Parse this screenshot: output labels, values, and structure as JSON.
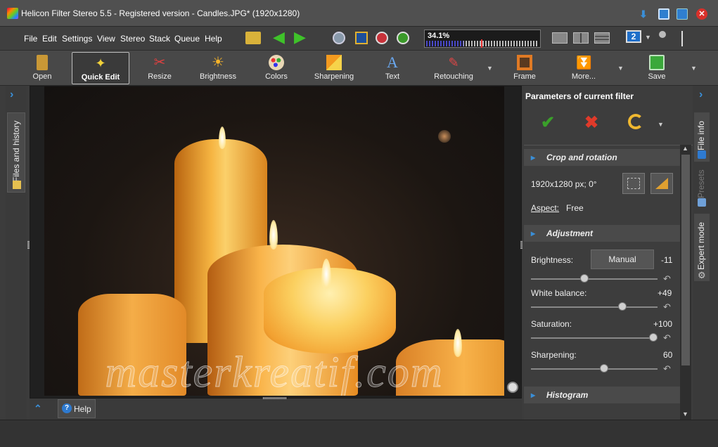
{
  "window": {
    "title": "Helicon Filter Stereo 5.5 - Registered version - Candles.JPG* (1920x1280)"
  },
  "menu": [
    "File",
    "Edit",
    "Settings",
    "View",
    "Stereo",
    "Stack",
    "Queue",
    "Help"
  ],
  "zoom": {
    "label": "34.1%",
    "value": 34.1
  },
  "monitor_badge": "2",
  "toolbar": {
    "open": "Open",
    "quick_edit": "Quick Edit",
    "resize": "Resize",
    "brightness": "Brightness",
    "colors": "Colors",
    "sharpening": "Sharpening",
    "text": "Text",
    "retouching": "Retouching",
    "frame": "Frame",
    "more": "More...",
    "save": "Save"
  },
  "left_tab": "Files and history",
  "right_tabs": {
    "file_info": "File info",
    "presets": "Presets",
    "expert": "Expert mode"
  },
  "panel": {
    "title": "Parameters of current filter",
    "crop": {
      "header": "Crop and rotation",
      "info": "1920x1280 px;  0°",
      "aspect_label": "Aspect:",
      "aspect_value": "Free"
    },
    "adjustment": {
      "header": "Adjustment",
      "brightness": {
        "label": "Brightness:",
        "mode": "Manual",
        "value": "-11",
        "level": 0.44
      },
      "white_balance": {
        "label": "White balance:",
        "value": "+49",
        "level": 0.71
      },
      "saturation": {
        "label": "Saturation:",
        "value": "+100",
        "level": 0.96
      },
      "sharpening": {
        "label": "Sharpening:",
        "value": "60",
        "level": 0.58
      }
    },
    "histogram": "Histogram"
  },
  "help_button": "Help",
  "watermark": "masterkreatif.com",
  "colors": {
    "accent": "#3a8fd8",
    "ok": "#3aa02a",
    "cancel": "#e03a2a"
  }
}
